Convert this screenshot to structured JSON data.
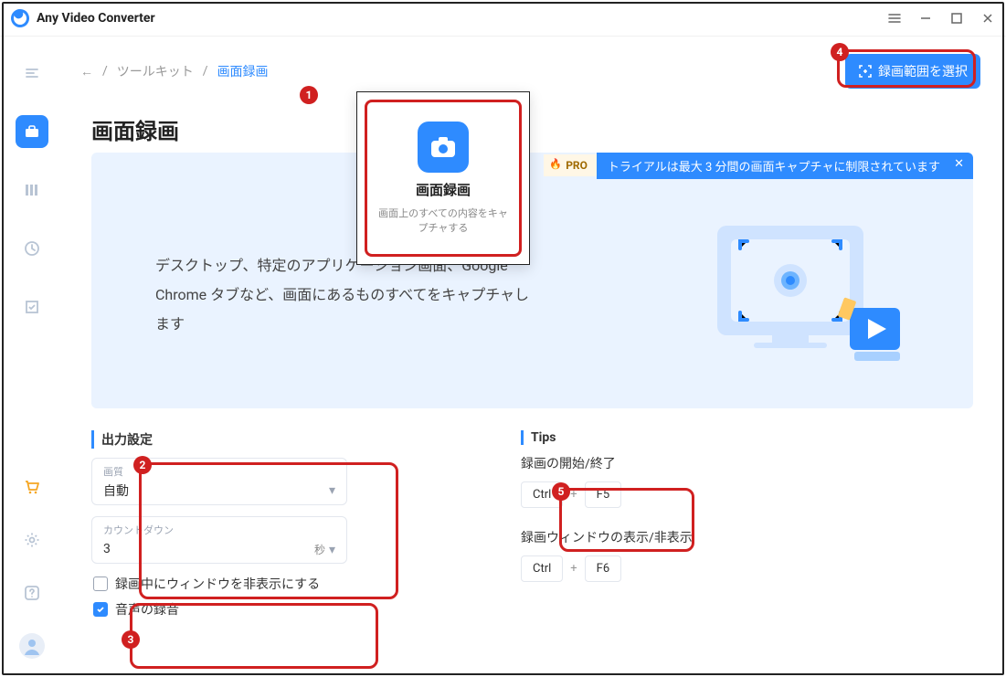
{
  "app": {
    "name": "Any Video Converter"
  },
  "breadcrumb": {
    "back": "←",
    "sep": "/",
    "parent": "ツールキット",
    "current": "画面録画"
  },
  "select_area_btn": "録画範囲を選択",
  "page_title": "画面録画",
  "pro": {
    "tag": "PRO",
    "msg": "トライアルは最大 3 分間の画面キャプチャに制限されています",
    "close": "✕"
  },
  "banner_desc": "デスクトップ、特定のアプリケーション画面、Google Chrome タブなど、画面にあるものすべてをキャプチャします",
  "feature_card": {
    "title": "画面録画",
    "sub": "画面上のすべての内容をキャプチャする"
  },
  "output": {
    "heading": "出力設定",
    "quality_label": "画質",
    "quality_value": "自動",
    "countdown_label": "カウントダウン",
    "countdown_value": "3",
    "countdown_unit": "秒",
    "hide_window": "録画中にウィンドウを非表示にする",
    "record_audio": "音声の録音"
  },
  "tips": {
    "heading": "Tips",
    "start_stop": "録画の開始/終了",
    "start_stop_keys": [
      "Ctrl",
      "F5"
    ],
    "toggle_window": "録画ウィンドウの表示/非表示",
    "toggle_window_keys": [
      "Ctrl",
      "F6"
    ]
  },
  "badges": {
    "b1": "1",
    "b2": "2",
    "b3": "3",
    "b4": "4",
    "b5": "5"
  }
}
